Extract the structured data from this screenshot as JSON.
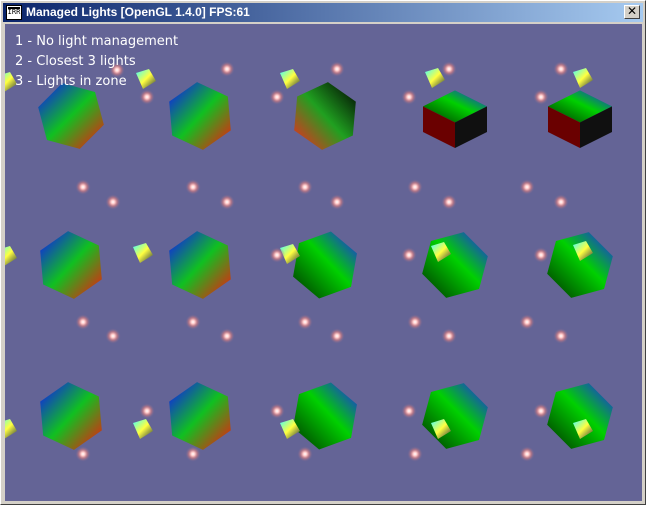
{
  "window": {
    "icon_text": "IRR",
    "title": "Managed Lights [OpenGL 1.4.0] FPS:61",
    "close_glyph": "✕"
  },
  "hud": {
    "lines": [
      "1 - No light management",
      "2 - Closest 3 lights",
      "3 - Lights in zone"
    ]
  },
  "scene": {
    "background_color": "#646496",
    "light_color": "#ffb4b4",
    "cube_colors": [
      "#0000ff",
      "#00ff00",
      "#ff0000",
      "#000000"
    ]
  }
}
